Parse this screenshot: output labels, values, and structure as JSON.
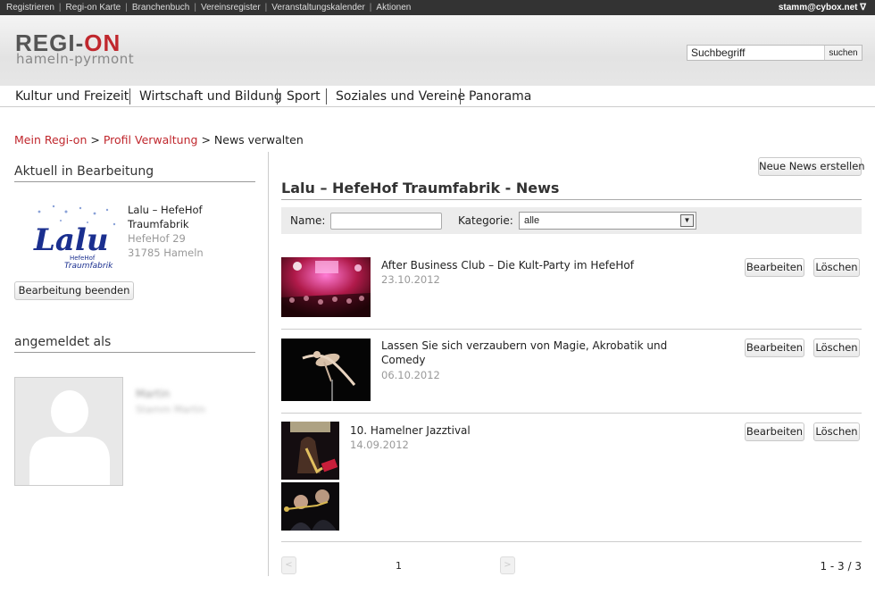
{
  "topbar": {
    "links": [
      "Registrieren",
      "Regi-on Karte",
      "Branchenbuch",
      "Vereinsregister",
      "Veranstaltungskalender",
      "Aktionen"
    ],
    "user_email": "stamm@cybox.net",
    "user_caret": "∇"
  },
  "brand": {
    "logo_main_a": "REGI-",
    "logo_main_b": "ON",
    "logo_sub": "hameln-pyrmont"
  },
  "search": {
    "value": "Suchbegriff",
    "button": "suchen"
  },
  "mainnav": [
    "Kultur und Freizeit",
    "Wirtschaft und Bildung",
    "Sport",
    "Soziales und Vereine",
    "Panorama"
  ],
  "breadcrumb": {
    "items": [
      "Mein Regi-on",
      "Profil Verwaltung",
      "News verwalten"
    ],
    "separator": ">"
  },
  "sidebar": {
    "editing_heading": "Aktuell in Bearbeitung",
    "org": {
      "name_line1": "Lalu – HefeHof",
      "name_line2": "Traumfabrik",
      "street": "HefeHof 29",
      "city": "31785 Hameln",
      "logo_text": "Lalu",
      "logo_subtext_1": "HefeHof",
      "logo_subtext_2": "Traumfabrik"
    },
    "end_editing_button": "Bearbeitung beenden",
    "logged_in_heading": "angemeldet als",
    "user_name": "Martin",
    "user_sub": "Stamm Martin"
  },
  "content": {
    "create_button": "Neue News erstellen",
    "title": "Lalu – HefeHof Traumfabrik - News",
    "filter": {
      "name_label": "Name:",
      "name_value": "",
      "category_label": "Kategorie:",
      "category_value": "alle"
    },
    "news": [
      {
        "title": "After Business Club – Die Kult-Party im HefeHof",
        "date": "23.10.2012"
      },
      {
        "title_line1": "Lassen Sie sich verzaubern von Magie, Akrobatik und",
        "title_line2": "Comedy",
        "date": "06.10.2012"
      },
      {
        "title": "10. Hamelner Jazztival",
        "date": "14.09.2012"
      }
    ],
    "edit_label": "Bearbeiten",
    "delete_label": "Löschen",
    "pager": {
      "prev": "<",
      "next": ">",
      "page": "1",
      "count": "1 - 3 / 3"
    }
  }
}
